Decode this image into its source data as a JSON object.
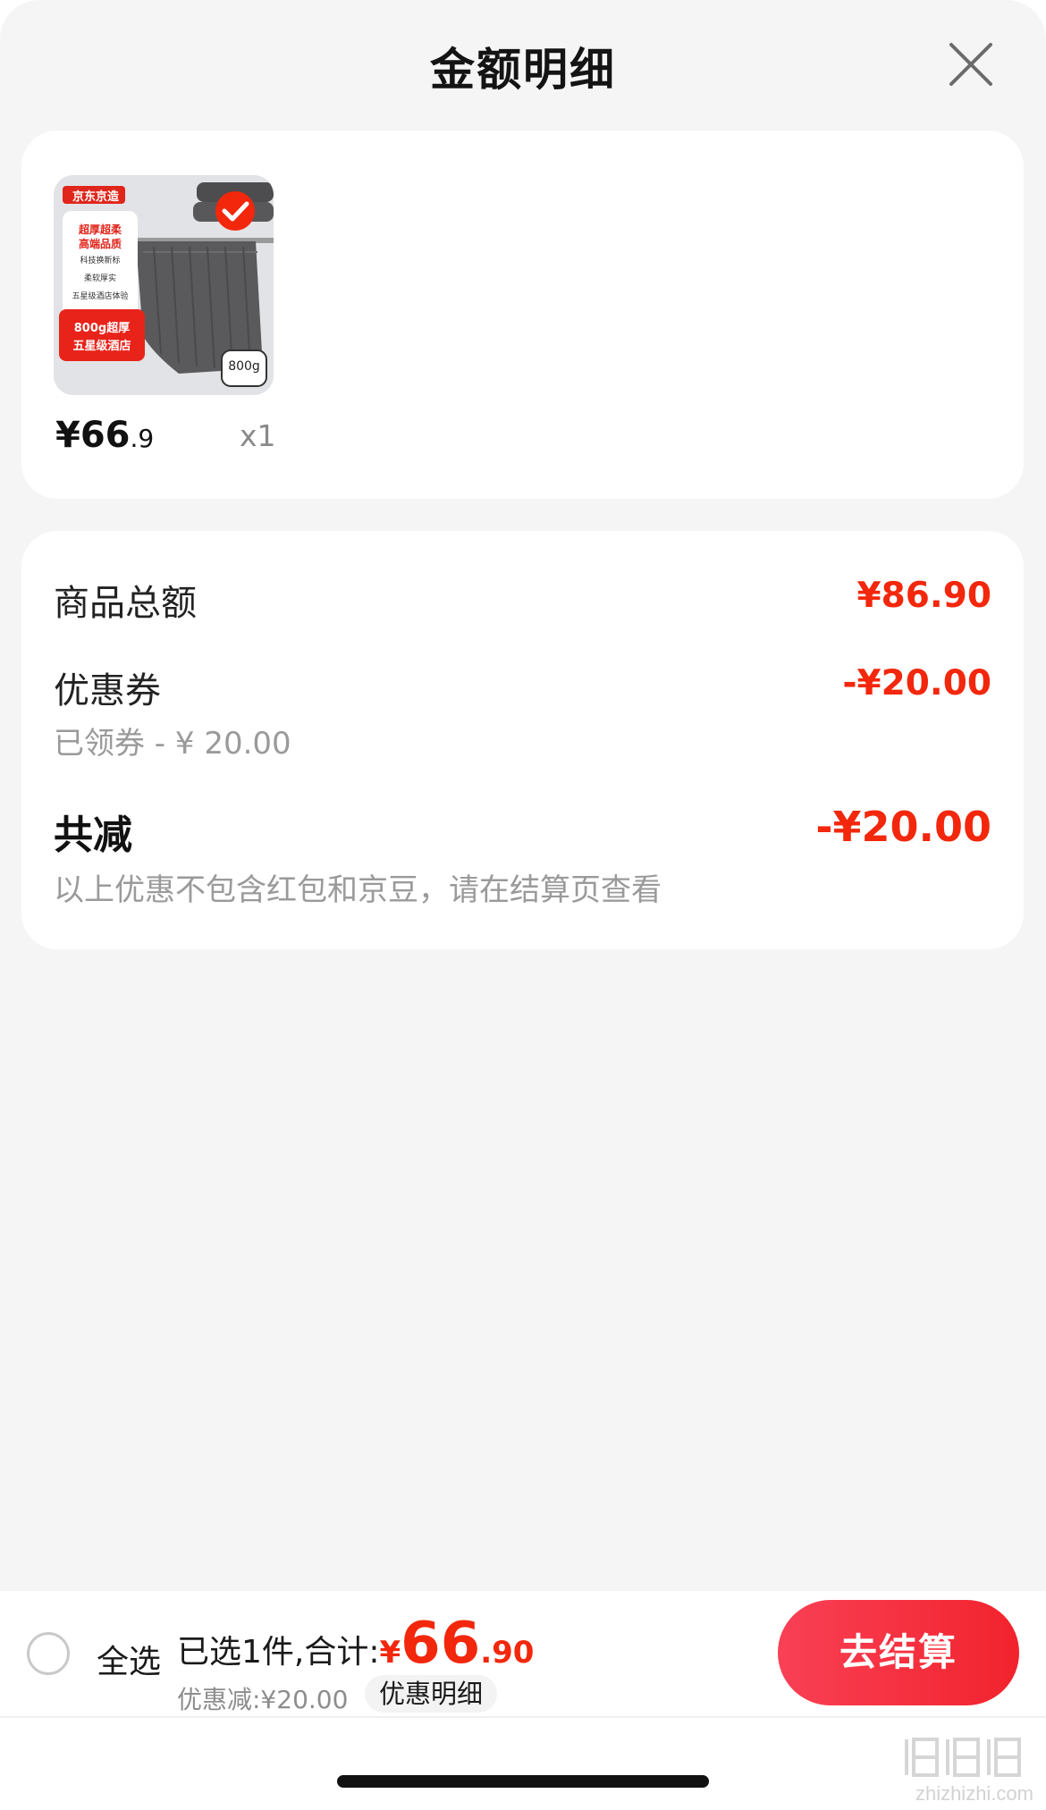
{
  "header": {
    "title": "金额明细",
    "close_icon": "close-icon"
  },
  "product": {
    "image_badge": "京东京造",
    "image_tagline_1": "超厚超柔",
    "image_tagline_2": "高端品质",
    "image_feature_1": "科技换新标",
    "image_feature_2": "柔软厚实",
    "image_feature_3": "五星级酒店体验",
    "image_promo_1": "800g超厚",
    "image_promo_2": "五星级酒店",
    "image_weight": "800g",
    "checked_icon": "check-icon",
    "price_main": "¥66",
    "price_decimal": ".9",
    "quantity": "x1"
  },
  "details": {
    "goods_total_label": "商品总额",
    "goods_total_value": "¥86.90",
    "coupon_label": "优惠券",
    "coupon_value": "-¥20.00",
    "coupon_sub": "已领券 - ¥ 20.00",
    "total_discount_label": "共减",
    "total_discount_value": "-¥20.00",
    "note": "以上优惠不包含红包和京豆，请在结算页查看"
  },
  "bottom_bar": {
    "select_all_label": "全选",
    "selected_prefix": "已选1件,合计:",
    "total_yen": "¥",
    "total_int": "66",
    "total_dec": ".90",
    "discount_text": "优惠减:¥20.00",
    "detail_chip": "优惠明细",
    "checkout_label": "去结算"
  },
  "watermark": {
    "text": "zhizhizhi.com"
  },
  "colors": {
    "accent": "#f2270c",
    "checkout_start": "#f94055",
    "checkout_end": "#f1232d",
    "background": "#f5f5f5"
  }
}
